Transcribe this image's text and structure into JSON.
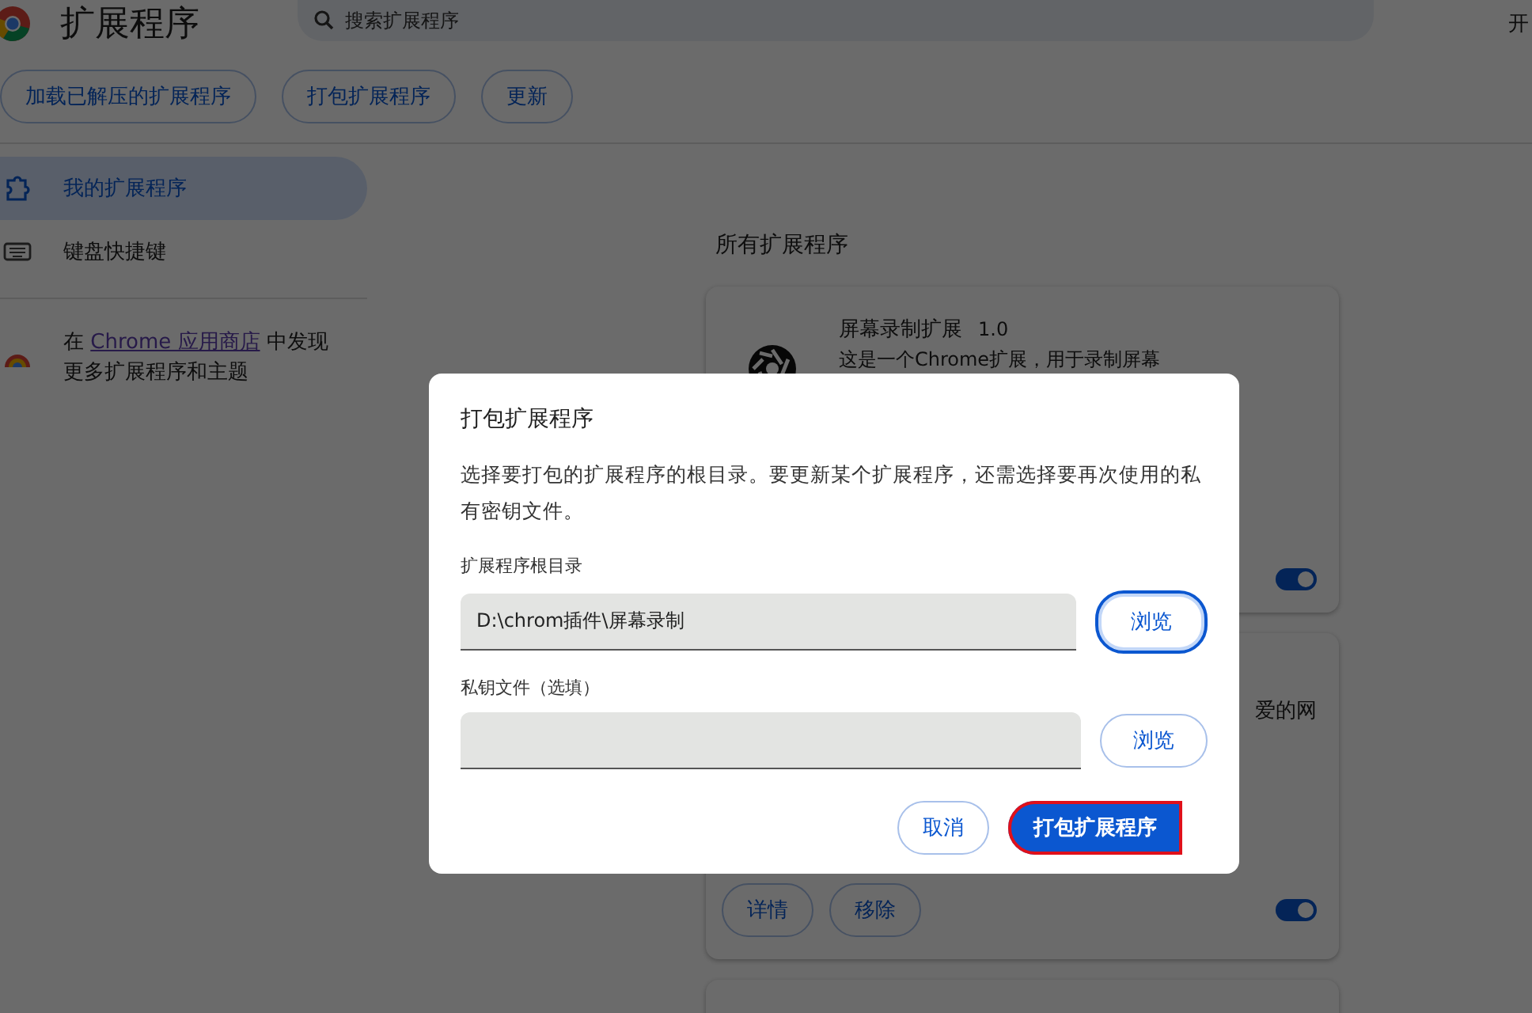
{
  "header": {
    "title": "扩展程序",
    "search_placeholder": "搜索扩展程序",
    "corner_text": "开"
  },
  "toolbar": [
    "加载已解压的扩展程序",
    "打包扩展程序",
    "更新"
  ],
  "sidebar": {
    "items": [
      {
        "kind": "extensions",
        "label": "我的扩展程序",
        "selected": true
      },
      {
        "kind": "keyboard",
        "label": "键盘快捷键",
        "selected": false
      }
    ],
    "store_prefix": "在 ",
    "store_link": "Chrome 应用商店",
    "store_suffix": " 中发现更多扩展程序和主题"
  },
  "main": {
    "heading": "所有扩展程序",
    "cards": [
      {
        "name": "屏幕录制扩展",
        "version": "1.0",
        "description": "这是一个Chrome扩展，用于录制屏幕",
        "enabled": true
      },
      {
        "description": "爱的网",
        "buttons": [
          "详情",
          "移除"
        ],
        "enabled": true
      }
    ]
  },
  "dialog": {
    "title": "打包扩展程序",
    "description": "选择要打包的扩展程序的根目录。要更新某个扩展程序，还需选择要再次使用的私有密钥文件。",
    "fields": [
      {
        "label": "扩展程序根目录",
        "value": "D:\\chrom插件\\屏幕录制",
        "button": "浏览",
        "focused": true
      },
      {
        "label": "私钥文件（选填）",
        "button": "浏览",
        "focused": false
      }
    ],
    "actions": [
      {
        "label": "取消",
        "kind": "secondary"
      },
      {
        "label": "打包扩展程序",
        "kind": "primary",
        "highlighted": true
      }
    ]
  }
}
